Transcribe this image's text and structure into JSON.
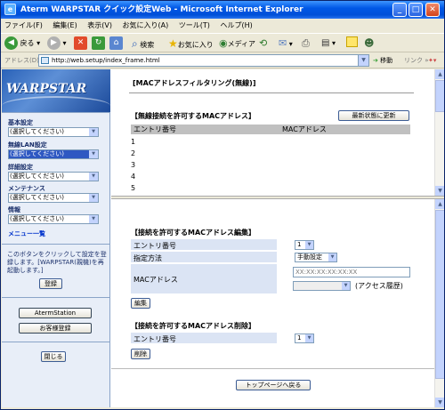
{
  "window": {
    "title": "Aterm WARPSTAR クイック設定Web - Microsoft Internet Explorer"
  },
  "menu": [
    "ファイル(F)",
    "編集(E)",
    "表示(V)",
    "お気に入り(A)",
    "ツール(T)",
    "ヘルプ(H)"
  ],
  "toolbar": {
    "back": "戻る",
    "search": "検索",
    "favorites": "お気に入り",
    "media": "メディア"
  },
  "address": {
    "label": "アドレス(D)",
    "url": "http://web.setup/index_frame.html",
    "go": "移動",
    "links": "リンク"
  },
  "sidebar": {
    "logo": "WARPSTAR",
    "groups": [
      {
        "label": "基本設定",
        "value": "(選択してください)"
      },
      {
        "label": "無線LAN設定",
        "value": "(選択してください)"
      },
      {
        "label": "詳細設定",
        "value": "(選択してください)"
      },
      {
        "label": "メンテナンス",
        "value": "(選択してください)"
      },
      {
        "label": "情報",
        "value": "(選択してください)"
      }
    ],
    "menu_link": "メニュー一覧",
    "note": "このボタンをクリックして設定を登録します。[WARPSTAR(親機)を再起動します。]",
    "register": "登録",
    "aterm_station": "AtermStation",
    "customer_register": "お客様登録",
    "close": "閉じる"
  },
  "top": {
    "title": "[MACアドレスフィルタリング(無線)]",
    "section": "【無線接続を許可するMACアドレス】",
    "refresh": "最新状態に更新",
    "col_entry": "エントリ番号",
    "col_mac": "MACアドレス",
    "rows": [
      "1",
      "2",
      "3",
      "4",
      "5"
    ]
  },
  "edit": {
    "title": "【接続を許可するMACアドレス編集】",
    "entry_label": "エントリ番号",
    "entry_value": "1",
    "method_label": "指定方法",
    "method_value": "手動設定",
    "mac_label": "MACアドレス",
    "mac_placeholder": "XX:XX:XX:XX:XX:XX",
    "history": "(アクセス履歴)",
    "edit_button": "編集"
  },
  "delete": {
    "title": "【接続を許可するMACアドレス削除】",
    "entry_label": "エントリ番号",
    "entry_value": "1",
    "delete_button": "削除"
  },
  "top_page": "トップページへ戻る"
}
